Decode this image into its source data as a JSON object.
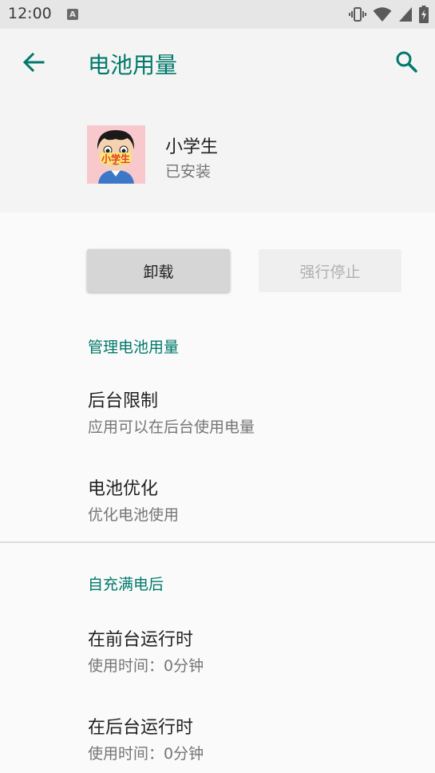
{
  "status_bar": {
    "time": "12:00",
    "notification_icon_letter": "A",
    "icons": [
      "vibrate-icon",
      "wifi-icon",
      "signal-icon",
      "battery-charging-icon"
    ]
  },
  "app_bar": {
    "title": "电池用量",
    "back_icon": "arrow-back-icon",
    "search_icon": "search-icon",
    "accent_color": "#00796b"
  },
  "app_header": {
    "name": "小学生",
    "status": "已安装",
    "icon_text": "小学生"
  },
  "buttons": {
    "uninstall": "卸载",
    "force_stop": "强行停止"
  },
  "sections": [
    {
      "header": "管理电池用量",
      "items": [
        {
          "title": "后台限制",
          "summary": "应用可以在后台使用电量"
        },
        {
          "title": "电池优化",
          "summary": "优化电池使用"
        }
      ]
    },
    {
      "header": "自充满电后",
      "items": [
        {
          "title": "在前台运行时",
          "summary": "使用时间：0分钟"
        },
        {
          "title": "在后台运行时",
          "summary": "使用时间：0分钟"
        }
      ]
    }
  ]
}
